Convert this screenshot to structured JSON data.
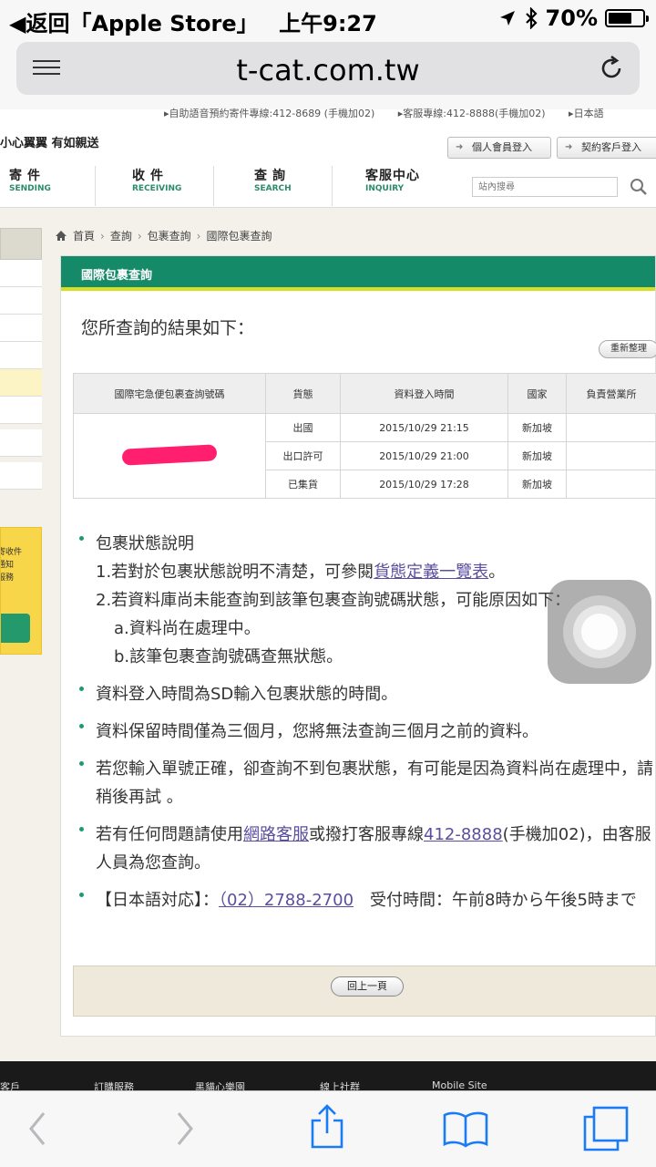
{
  "status_bar": {
    "back_app": "◀返回「Apple Store」",
    "time": "上午9:27",
    "battery": "70%",
    "battery_level": 0.7
  },
  "browser": {
    "url": "t-cat.com.tw"
  },
  "header": {
    "top_strip": [
      "▸自助語音預約寄件專線:412-8689 (手機加02)",
      "▸客服專線:412-8888(手機加02)",
      "▸日本語"
    ],
    "slogan": "小心翼翼 有如親送",
    "member_login": "個人會員登入",
    "contract_login": "契約客戶登入",
    "nav": [
      {
        "zh": "寄件",
        "en": "SENDING"
      },
      {
        "zh": "收件",
        "en": "RECEIVING"
      },
      {
        "zh": "查詢",
        "en": "SEARCH"
      },
      {
        "zh": "客服中心",
        "en": "INQUIRY"
      }
    ],
    "search_placeholder": "站內搜尋"
  },
  "sidebar": {
    "promo_text": "寄收件\n通知\n服務"
  },
  "breadcrumb": [
    "首頁",
    "查詢",
    "包裹查詢",
    "國際包裹查詢"
  ],
  "panel": {
    "title": "國際包裹查詢",
    "result_heading": "您所查詢的結果如下：",
    "reset_label": "重新整理",
    "table": {
      "headers": [
        "國際宅急便包裹查詢號碼",
        "貨態",
        "資料登入時間",
        "國家",
        "負責營業所"
      ],
      "rows": [
        {
          "status": "出國",
          "time": "2015/10/29 21:15",
          "country": "新加坡",
          "office": ""
        },
        {
          "status": "出口許可",
          "time": "2015/10/29 21:00",
          "country": "新加坡",
          "office": ""
        },
        {
          "status": "已集貨",
          "time": "2015/10/29 17:28",
          "country": "新加坡",
          "office": ""
        }
      ]
    },
    "notes": {
      "n1_title": "包裹狀態說明",
      "n1_line1_pre": "1.若對於包裹狀態說明不清楚，可參閱",
      "n1_line1_link": "貨態定義一覽表",
      "n1_line1_post": "。",
      "n1_line2": "2.若資料庫尚未能查詢到該筆包裹查詢號碼狀態，可能原因如下：",
      "n1_line2a": "a.資料尚在處理中。",
      "n1_line2b": "b.該筆包裹查詢號碼查無狀態。",
      "n2": "資料登入時間為SD輸入包裹狀態的時間。",
      "n3": "資料保留時間僅為三個月，您將無法查詢三個月之前的資料。",
      "n4": "若您輸入單號正確，卻查詢不到包裹狀態，有可能是因為資料尚在處理中，請稍後再試 。",
      "n5_pre": "若有任何問題請使用",
      "n5_link1": "網路客服",
      "n5_mid": "或撥打客服專線",
      "n5_link2": "412-8888",
      "n5_post": "(手機加02)，由客服人員為您查詢。",
      "n6_pre": "【日本語対応】：",
      "n6_link": "（02）2788-2700",
      "n6_post": "　受付時間：午前8時から午後5時まで"
    },
    "back_label": "回上一頁"
  },
  "footer": [
    "客戶",
    "訂購服務",
    "黑貓心樂園",
    "線上社群",
    "Mobile Site"
  ]
}
